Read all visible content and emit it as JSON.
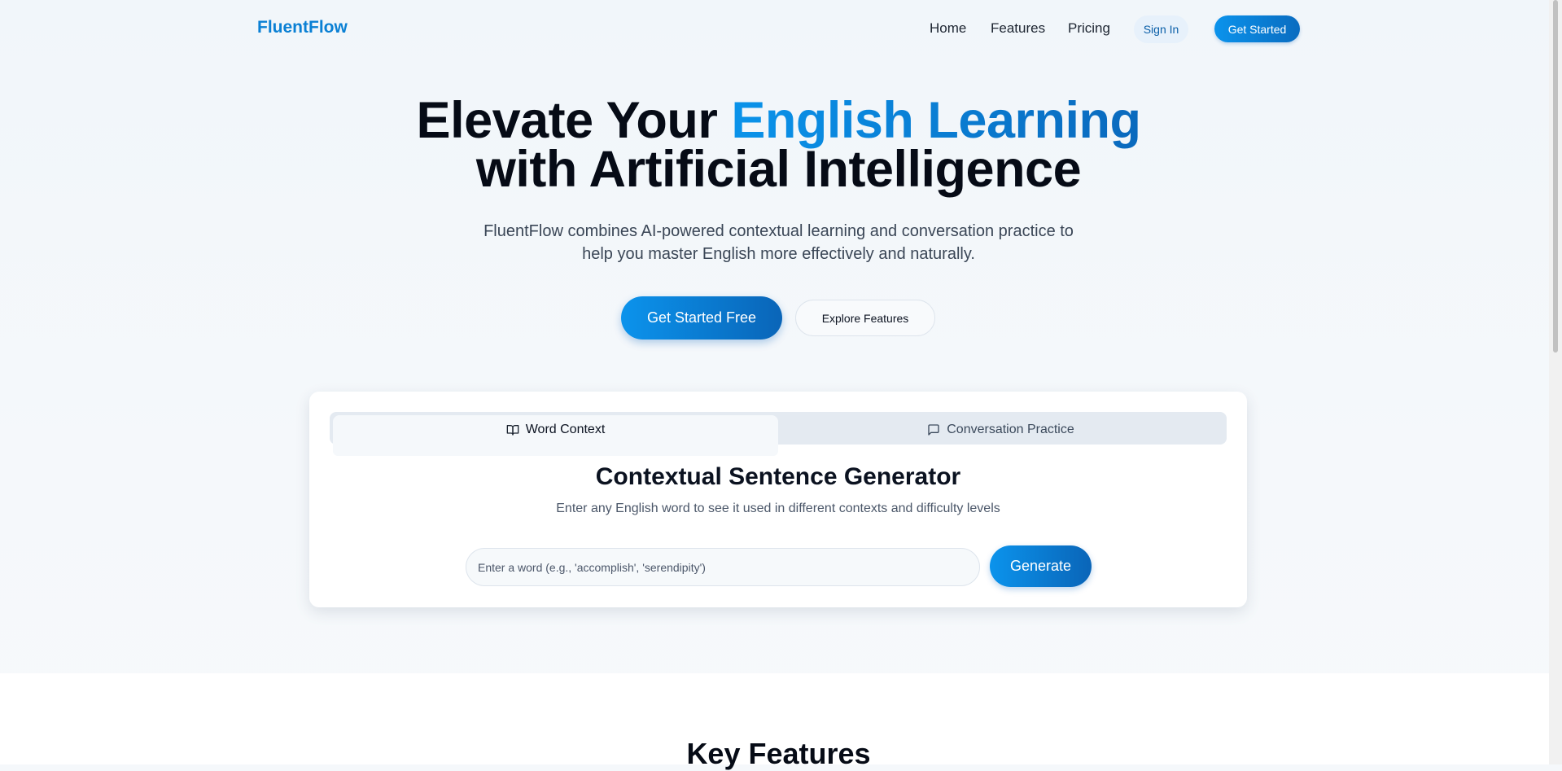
{
  "header": {
    "logo": "FluentFlow",
    "nav": {
      "home": "Home",
      "features": "Features",
      "pricing": "Pricing"
    },
    "sign_in": "Sign In",
    "get_started": "Get Started"
  },
  "hero": {
    "title_part1": "Elevate Your ",
    "title_accent": "English Learning",
    "title_line2": "with Artificial Intelligence",
    "subtitle_line1": "FluentFlow combines AI-powered contextual learning and conversation practice to",
    "subtitle_line2": "help you master English more effectively and naturally.",
    "primary_cta": "Get Started Free",
    "secondary_cta": "Explore Features"
  },
  "generator": {
    "tabs": [
      {
        "label": "Word Context",
        "icon": "book-open-icon",
        "active": true
      },
      {
        "label": "Conversation Practice",
        "icon": "message-square-icon",
        "active": false
      }
    ],
    "title": "Contextual Sentence Generator",
    "subtitle": "Enter any English word to see it used in different contexts and difficulty levels",
    "input": {
      "value": "",
      "placeholder": "Enter a word (e.g., 'accomplish', 'serendipity')"
    },
    "generate_label": "Generate"
  },
  "features": {
    "title": "Key Features"
  },
  "colors": {
    "brand": "#0a80d4",
    "accent_gradient_start": "#0b93ec",
    "accent_gradient_end": "#0a65b8"
  }
}
